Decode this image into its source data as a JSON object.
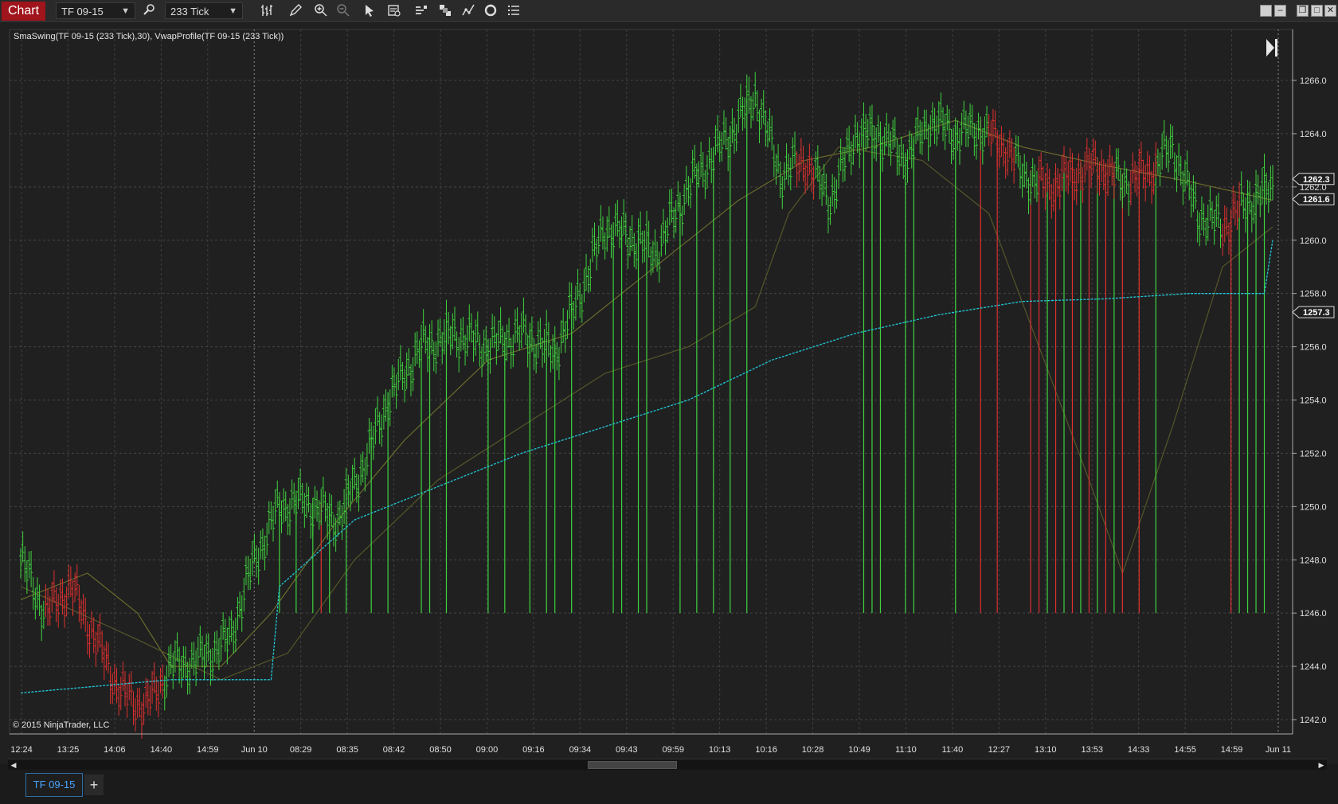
{
  "toolbar": {
    "chart_tab": "Chart",
    "instrument": "TF 09-15",
    "interval": "233 Tick",
    "icons": [
      "magnifier-icon",
      "bar-type-icon",
      "pencil-icon",
      "zoom-in-icon",
      "zoom-out-icon",
      "pointer-icon",
      "data-box-icon",
      "order-icon",
      "strategy-icon",
      "indicator-icon",
      "refresh-icon",
      "properties-icon"
    ]
  },
  "chart": {
    "indicator_label": "SmaSwing(TF 09-15 (233 Tick),30), VwapProfile(TF 09-15 (233 Tick))",
    "copyright": "© 2015 NinjaTrader, LLC",
    "price_markers": [
      "1262.3",
      "1261.6",
      "1257.3"
    ],
    "colors": {
      "up": "#3fd33f",
      "down": "#e03030",
      "vwap": "#21c8d8",
      "sma": "#6a6a2a",
      "background": "#202020"
    }
  },
  "chart_data": {
    "type": "bar",
    "y_ticks": [
      1266.0,
      1264.0,
      1262.0,
      1260.0,
      1258.0,
      1256.0,
      1254.0,
      1252.0,
      1250.0,
      1248.0,
      1246.0,
      1244.0,
      1242.0
    ],
    "ylim": [
      1241.0,
      1267.2
    ],
    "x_tick_labels": [
      "12:24",
      "13:25",
      "14:06",
      "14:40",
      "14:59",
      "Jun 10",
      "08:29",
      "08:35",
      "08:42",
      "08:50",
      "09:00",
      "09:16",
      "09:34",
      "09:43",
      "09:59",
      "10:13",
      "10:16",
      "10:28",
      "10:49",
      "11:10",
      "11:40",
      "12:27",
      "13:10",
      "13:53",
      "14:33",
      "14:55",
      "14:59",
      "Jun 11"
    ],
    "price_path": [
      [
        0,
        1248
      ],
      [
        3,
        1246
      ],
      [
        6,
        1247
      ],
      [
        9,
        1245
      ],
      [
        12,
        1243
      ],
      [
        15,
        1242.5
      ],
      [
        18,
        1244
      ],
      [
        21,
        1244.2
      ],
      [
        25,
        1245
      ],
      [
        28,
        1248
      ],
      [
        31,
        1250
      ],
      [
        34,
        1250.2
      ],
      [
        38,
        1249.5
      ],
      [
        41,
        1251.5
      ],
      [
        44,
        1254
      ],
      [
        48,
        1256
      ],
      [
        52,
        1256.5
      ],
      [
        56,
        1256
      ],
      [
        60,
        1256.5
      ],
      [
        64,
        1255.8
      ],
      [
        67,
        1258
      ],
      [
        70,
        1260.5
      ],
      [
        74,
        1260
      ],
      [
        76,
        1259.5
      ],
      [
        80,
        1262
      ],
      [
        85,
        1264
      ],
      [
        88,
        1265.5
      ],
      [
        91,
        1262.5
      ],
      [
        94,
        1263
      ],
      [
        97,
        1261.5
      ],
      [
        100,
        1264
      ],
      [
        103,
        1264
      ],
      [
        106,
        1263
      ],
      [
        109,
        1264.5
      ],
      [
        112,
        1264
      ],
      [
        115,
        1264.2
      ],
      [
        118,
        1263.5
      ],
      [
        120,
        1262.5
      ],
      [
        123,
        1262
      ],
      [
        126,
        1262.5
      ],
      [
        129,
        1262.8
      ],
      [
        132,
        1262.2
      ],
      [
        135,
        1262.5
      ],
      [
        138,
        1263.5
      ],
      [
        141,
        1261
      ],
      [
        144,
        1260.5
      ],
      [
        147,
        1261.5
      ],
      [
        150,
        1262
      ]
    ],
    "vwap_path": [
      [
        0,
        1243
      ],
      [
        18,
        1243.5
      ],
      [
        30,
        1243.5
      ],
      [
        31,
        1247
      ],
      [
        40,
        1249.5
      ],
      [
        60,
        1252
      ],
      [
        80,
        1254
      ],
      [
        90,
        1255.5
      ],
      [
        100,
        1256.5
      ],
      [
        110,
        1257.2
      ],
      [
        120,
        1257.7
      ],
      [
        130,
        1257.8
      ],
      [
        140,
        1258
      ],
      [
        149,
        1258
      ],
      [
        150,
        1260
      ]
    ],
    "sma_fast_path": [
      [
        0,
        1246.5
      ],
      [
        8,
        1247.5
      ],
      [
        14,
        1246
      ],
      [
        18,
        1244
      ],
      [
        24,
        1244
      ],
      [
        30,
        1246
      ],
      [
        38,
        1249.5
      ],
      [
        46,
        1252.5
      ],
      [
        56,
        1255.5
      ],
      [
        66,
        1256.5
      ],
      [
        76,
        1259
      ],
      [
        86,
        1261.5
      ],
      [
        94,
        1263
      ],
      [
        102,
        1263.5
      ],
      [
        112,
        1264.5
      ],
      [
        120,
        1263.5
      ],
      [
        130,
        1262.8
      ],
      [
        140,
        1262.2
      ],
      [
        150,
        1261.5
      ]
    ],
    "sma_slow_path": [
      [
        0,
        1247
      ],
      [
        14,
        1245
      ],
      [
        24,
        1243.5
      ],
      [
        32,
        1244.5
      ],
      [
        40,
        1248
      ],
      [
        50,
        1251
      ],
      [
        60,
        1253
      ],
      [
        70,
        1255
      ],
      [
        80,
        1256
      ],
      [
        88,
        1257.5
      ],
      [
        92,
        1261
      ],
      [
        98,
        1263.5
      ],
      [
        108,
        1263
      ],
      [
        116,
        1261
      ],
      [
        122,
        1256
      ],
      [
        128,
        1251
      ],
      [
        132,
        1247.5
      ],
      [
        138,
        1253
      ],
      [
        144,
        1259
      ],
      [
        150,
        1260.5
      ]
    ],
    "red_bar_ranges": [
      [
        3,
        17
      ],
      [
        93,
        95
      ],
      [
        116,
        119
      ],
      [
        122,
        131
      ],
      [
        133,
        136
      ],
      [
        144,
        146
      ]
    ],
    "ray_bars": [
      {
        "i": 31,
        "c": "up"
      },
      {
        "i": 33,
        "c": "up"
      },
      {
        "i": 35,
        "c": "up"
      },
      {
        "i": 36,
        "c": "down"
      },
      {
        "i": 37,
        "c": "up"
      },
      {
        "i": 39,
        "c": "up"
      },
      {
        "i": 42,
        "c": "up"
      },
      {
        "i": 44,
        "c": "up"
      },
      {
        "i": 48,
        "c": "up"
      },
      {
        "i": 49,
        "c": "up"
      },
      {
        "i": 51,
        "c": "up"
      },
      {
        "i": 56,
        "c": "up"
      },
      {
        "i": 58,
        "c": "up"
      },
      {
        "i": 61,
        "c": "up"
      },
      {
        "i": 63,
        "c": "up"
      },
      {
        "i": 64,
        "c": "up"
      },
      {
        "i": 66,
        "c": "up"
      },
      {
        "i": 71,
        "c": "up"
      },
      {
        "i": 72,
        "c": "up"
      },
      {
        "i": 74,
        "c": "up"
      },
      {
        "i": 75,
        "c": "up"
      },
      {
        "i": 79,
        "c": "up"
      },
      {
        "i": 81,
        "c": "up"
      },
      {
        "i": 83,
        "c": "up"
      },
      {
        "i": 85,
        "c": "up"
      },
      {
        "i": 87,
        "c": "up"
      },
      {
        "i": 101,
        "c": "up"
      },
      {
        "i": 102,
        "c": "up"
      },
      {
        "i": 103,
        "c": "up"
      },
      {
        "i": 106,
        "c": "up"
      },
      {
        "i": 107,
        "c": "up"
      },
      {
        "i": 112,
        "c": "up"
      },
      {
        "i": 115,
        "c": "down"
      },
      {
        "i": 117,
        "c": "down"
      },
      {
        "i": 121,
        "c": "down"
      },
      {
        "i": 122,
        "c": "down"
      },
      {
        "i": 123,
        "c": "up"
      },
      {
        "i": 124,
        "c": "down"
      },
      {
        "i": 125,
        "c": "up"
      },
      {
        "i": 126,
        "c": "down"
      },
      {
        "i": 127,
        "c": "up"
      },
      {
        "i": 128,
        "c": "down"
      },
      {
        "i": 129,
        "c": "up"
      },
      {
        "i": 130,
        "c": "down"
      },
      {
        "i": 131,
        "c": "up"
      },
      {
        "i": 132,
        "c": "down"
      },
      {
        "i": 134,
        "c": "down"
      },
      {
        "i": 136,
        "c": "up"
      },
      {
        "i": 145,
        "c": "down"
      },
      {
        "i": 146,
        "c": "up"
      },
      {
        "i": 147,
        "c": "up"
      },
      {
        "i": 148,
        "c": "up"
      },
      {
        "i": 149,
        "c": "up"
      }
    ]
  },
  "tabs": {
    "instrument_tab": "TF 09-15",
    "add_tab": "+"
  },
  "window": {
    "buttons": [
      "minimize",
      "restore",
      "maximize",
      "close"
    ]
  }
}
